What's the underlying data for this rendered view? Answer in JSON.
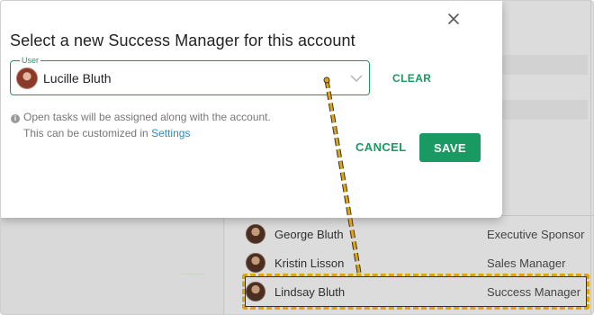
{
  "modal": {
    "title": "Select a new Success Manager for this account",
    "field_label": "User",
    "selected_user": "Lucille Bluth",
    "clear_label": "CLEAR",
    "info_line1": "Open tasks will be assigned along with the account.",
    "info_line2_prefix": "This can be customized in ",
    "info_link": "Settings",
    "cancel_label": "CANCEL",
    "save_label": "SAVE"
  },
  "contacts": [
    {
      "name": "George Bluth",
      "role": "Executive Sponsor"
    },
    {
      "name": "Kristin Lisson",
      "role": "Sales Manager"
    },
    {
      "name": "Lindsay Bluth",
      "role": "Success Manager"
    }
  ],
  "colors": {
    "accent": "#1a9a63",
    "link": "#2b8cc9",
    "highlight": "#e1a50c"
  },
  "icons": {
    "close": "close-icon",
    "dropdown": "chevron-down-icon",
    "info": "info-icon"
  }
}
